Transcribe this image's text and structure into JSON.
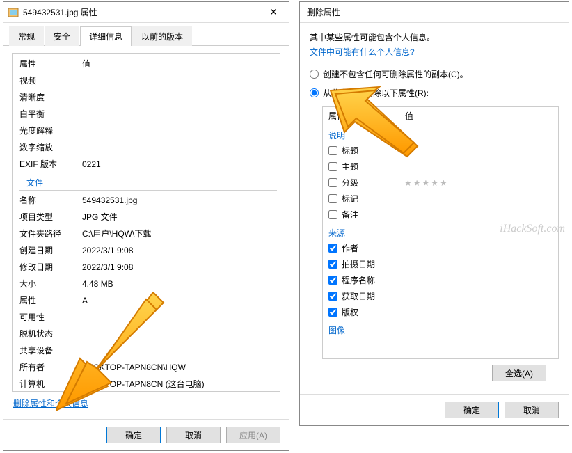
{
  "left": {
    "title": "549432531.jpg 属性",
    "tabs": [
      "常规",
      "安全",
      "详细信息",
      "以前的版本"
    ],
    "activeTab": 2,
    "headerName": "属性",
    "headerVal": "值",
    "sections": [
      {
        "rows": [
          {
            "name": "视频",
            "val": ""
          },
          {
            "name": "清晰度",
            "val": ""
          },
          {
            "name": "白平衡",
            "val": ""
          },
          {
            "name": "光度解释",
            "val": ""
          },
          {
            "name": "数字缩放",
            "val": ""
          },
          {
            "name": "EXIF 版本",
            "val": "0221"
          }
        ]
      },
      {
        "title": "文件",
        "rows": [
          {
            "name": "名称",
            "val": "549432531.jpg"
          },
          {
            "name": "项目类型",
            "val": "JPG 文件"
          },
          {
            "name": "文件夹路径",
            "val": "C:\\用户\\HQW\\下载"
          },
          {
            "name": "创建日期",
            "val": "2022/3/1 9:08"
          },
          {
            "name": "修改日期",
            "val": "2022/3/1 9:08"
          },
          {
            "name": "大小",
            "val": "4.48 MB"
          },
          {
            "name": "属性",
            "val": "A"
          },
          {
            "name": "可用性",
            "val": ""
          },
          {
            "name": "脱机状态",
            "val": ""
          },
          {
            "name": "共享设备",
            "val": ""
          },
          {
            "name": "所有者",
            "val": "DESKTOP-TAPN8CN\\HQW"
          },
          {
            "name": "计算机",
            "val": "DESKTOP-TAPN8CN (这台电脑)"
          }
        ]
      }
    ],
    "removeLink": "删除属性和个人信息",
    "buttons": {
      "ok": "确定",
      "cancel": "取消",
      "apply": "应用(A)"
    }
  },
  "right": {
    "title": "删除属性",
    "info": "其中某些属性可能包含个人信息。",
    "infoLink": "文件中可能有什么个人信息?",
    "radio1": "创建不包含任何可删除属性的副本(C)。",
    "radio2": "从此文件中删除以下属性(R):",
    "headerName": "属性",
    "headerVal": "值",
    "sections": [
      {
        "title": "说明",
        "items": [
          {
            "label": "标题",
            "checked": false,
            "val": ""
          },
          {
            "label": "主题",
            "checked": false,
            "val": ""
          },
          {
            "label": "分级",
            "checked": false,
            "val": "",
            "stars": true
          },
          {
            "label": "标记",
            "checked": false,
            "val": ""
          },
          {
            "label": "备注",
            "checked": false,
            "val": ""
          }
        ]
      },
      {
        "title": "来源",
        "items": [
          {
            "label": "作者",
            "checked": true,
            "val": ""
          },
          {
            "label": "拍摄日期",
            "checked": true,
            "val": ""
          },
          {
            "label": "程序名称",
            "checked": true,
            "val": ""
          },
          {
            "label": "获取日期",
            "checked": true,
            "val": ""
          },
          {
            "label": "版权",
            "checked": true,
            "val": ""
          }
        ]
      },
      {
        "title": "图像",
        "items": []
      }
    ],
    "selectAll": "全选(A)",
    "buttons": {
      "ok": "确定",
      "cancel": "取消"
    }
  },
  "watermark": "iHackSoft.com"
}
